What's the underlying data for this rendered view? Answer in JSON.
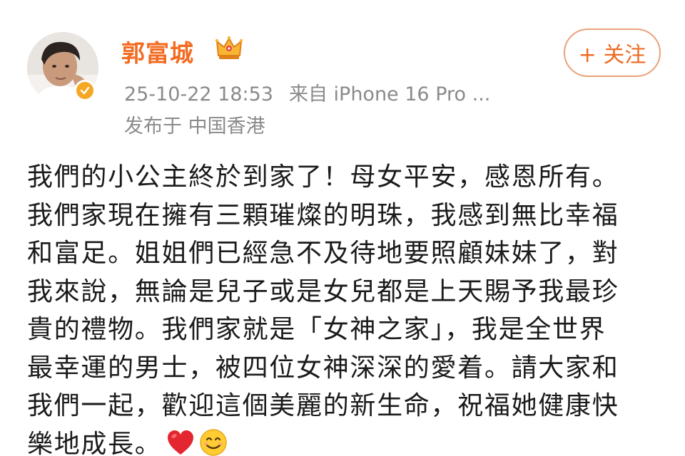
{
  "post": {
    "author": {
      "name": "郭富城",
      "avatar_icon": "user-avatar",
      "verified_icon": "verified-badge-icon",
      "crown_icon": "crown-icon"
    },
    "meta": {
      "timestamp": "25-10-22 18:53",
      "source": "来自 iPhone 16 Pro ...",
      "location": "发布于 中国香港"
    },
    "follow_button": {
      "label": "+ 关注"
    },
    "content_lines": [
      "我們的小公主終於到家了！母女平安，感恩所有。",
      "我們家現在擁有三顆璀燦的明珠，我感到無比幸福",
      "和富足。姐姐們已經急不及待地要照顧妹妹了，對",
      "我來說，無論是兒子或是女兒都是上天賜予我最珍",
      "貴的禮物。我們家就是「女神之家」，我是全世界",
      "最幸運的男士，被四位女神深深的愛着。請大家和",
      "我們一起，歡迎這個美麗的新生命，祝福她健康快",
      "樂地成長。"
    ],
    "trailing_emojis": [
      "heart-emoji",
      "smile-emoji"
    ],
    "colors": {
      "username": "#f26b21",
      "meta_text": "#8a8a8a",
      "follow_border": "#e8a27a",
      "follow_text": "#ee6b23",
      "verified_badge": "#f5a623",
      "body_text": "#1b1b1b"
    }
  }
}
